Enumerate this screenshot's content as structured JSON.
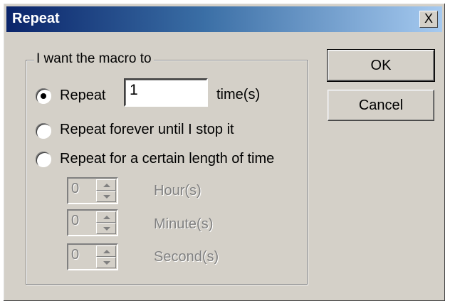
{
  "window": {
    "title": "Repeat",
    "close_glyph": "X"
  },
  "group": {
    "legend": "I want the macro to"
  },
  "options": {
    "repeat": {
      "label": "Repeat",
      "selected": true
    },
    "times_value": "1",
    "times_unit": "time(s)",
    "forever": {
      "label": "Repeat forever until I stop it",
      "selected": false
    },
    "duration": {
      "label": "Repeat for a certain length of time",
      "selected": false
    }
  },
  "duration_fields": [
    {
      "value": "0",
      "unit": "Hour(s)"
    },
    {
      "value": "0",
      "unit": "Minute(s)"
    },
    {
      "value": "0",
      "unit": "Second(s)"
    }
  ],
  "buttons": {
    "ok": "OK",
    "cancel": "Cancel"
  }
}
